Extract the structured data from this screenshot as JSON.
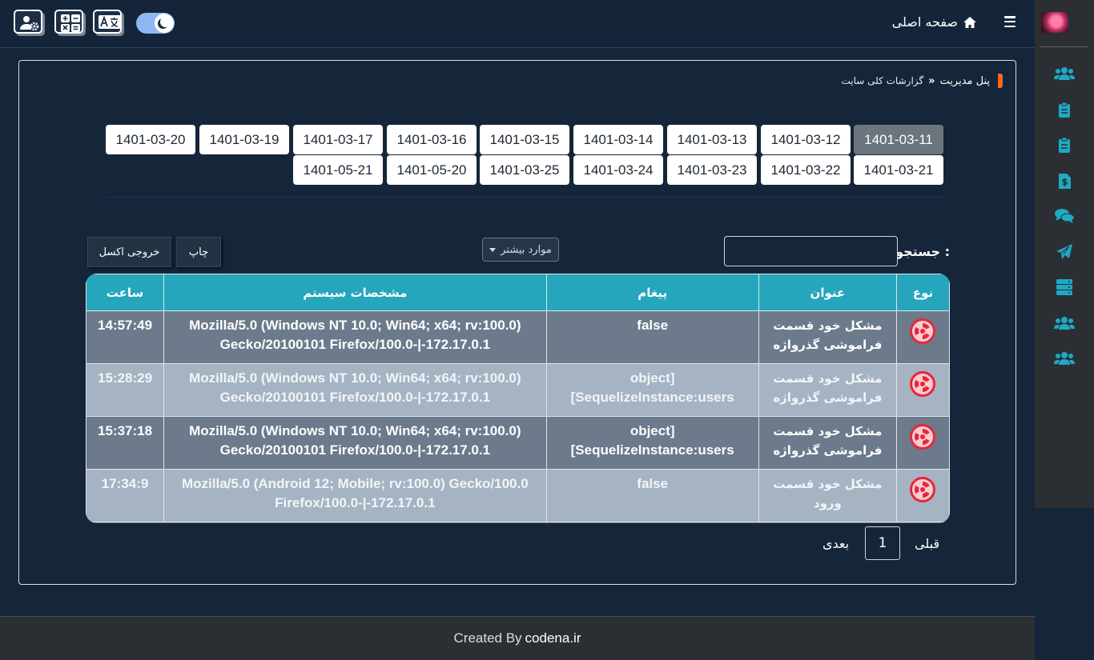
{
  "header": {
    "home_label": "صفحه اصلی",
    "icons": [
      "user-settings-icon",
      "calculator-icon",
      "translate-icon",
      "dark-mode-toggle",
      "home-icon",
      "hamburger-icon"
    ]
  },
  "sidebar": {
    "items": [
      {
        "icon": "users-icon"
      },
      {
        "icon": "clipboard-icon"
      },
      {
        "icon": "clipboard-icon"
      },
      {
        "icon": "invoice-dollar-icon"
      },
      {
        "icon": "comments-icon"
      },
      {
        "icon": "paper-plane-icon"
      },
      {
        "icon": "server-icon"
      },
      {
        "icon": "users-icon"
      },
      {
        "icon": "users-icon"
      }
    ],
    "accent": "#1ea9c4"
  },
  "breadcrumb": {
    "root": "پنل مدیریت",
    "current": "گزارشات کلی سایت"
  },
  "dates": {
    "row1": [
      "1401-03-11",
      "1401-03-12",
      "1401-03-13",
      "1401-03-14",
      "1401-03-15",
      "1401-03-16",
      "1401-03-17",
      "1401-03-19",
      "1401-03-20"
    ],
    "row2": [
      "1401-03-21",
      "1401-03-22",
      "1401-03-23",
      "1401-03-24",
      "1401-03-25",
      "1401-05-20",
      "1401-05-21"
    ],
    "active": "1401-03-11"
  },
  "toolbar": {
    "search_label": "جستجو :",
    "search_value": "",
    "more_label": "موارد بیشتر",
    "print_label": "چاپ",
    "excel_label": "خروجی اکسل"
  },
  "table": {
    "headers": {
      "type": "نوع",
      "title": "عنوان",
      "message": "پیغام",
      "system": "مشخصات سیستم",
      "time": "ساعت"
    },
    "rows": [
      {
        "title": "مشکل خود قسمت فراموشی گذرواژه",
        "message": "false",
        "system": "Mozilla/5.0 (Windows NT 10.0; Win64; x64; rv:100.0) Gecko/20100101 Firefox/100.0-|-172.17.0.1",
        "time": "14:57:49"
      },
      {
        "title": "مشکل خود قسمت فراموشی گذرواژه",
        "message": "[object SequelizeInstance:users]",
        "system": "Mozilla/5.0 (Windows NT 10.0; Win64; x64; rv:100.0) Gecko/20100101 Firefox/100.0-|-172.17.0.1",
        "time": "15:28:29"
      },
      {
        "title": "مشکل خود قسمت فراموشی گذرواژه",
        "message": "[object SequelizeInstance:users]",
        "system": "Mozilla/5.0 (Windows NT 10.0; Win64; x64; rv:100.0) Gecko/20100101 Firefox/100.0-|-172.17.0.1",
        "time": "15:37:18"
      },
      {
        "title": "مشکل خود قسمت ورود",
        "message": "false",
        "system": "Mozilla/5.0 (Android 12; Mobile; rv:100.0) Gecko/100.0 Firefox/100.0-|-172.17.0.1",
        "time": "17:34:9"
      }
    ]
  },
  "pagination": {
    "prev_label": "قبلی",
    "next_label": "بعدی",
    "current_page": "1"
  },
  "footer": {
    "prefix": "Created By",
    "brand": "codena.ir"
  }
}
